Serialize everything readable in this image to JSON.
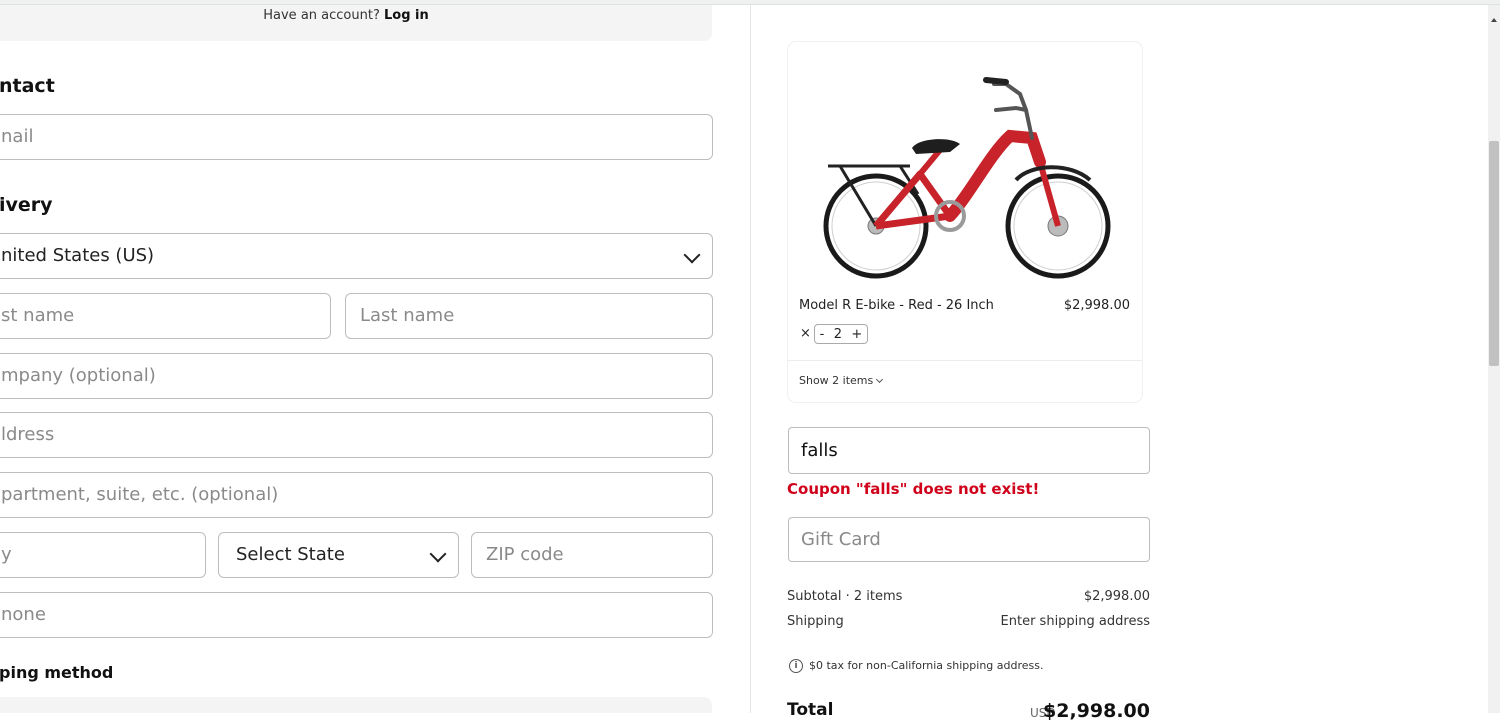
{
  "header": {
    "account_prompt": "Have an account?",
    "login_link": "Log in"
  },
  "contact": {
    "title": "ntact",
    "email_placeholder": "nail"
  },
  "delivery": {
    "title": "ivery",
    "country_value": "nited States (US)",
    "first_name_placeholder": "st name",
    "last_name_placeholder": "Last name",
    "company_placeholder": "mpany (optional)",
    "address_placeholder": "ldress",
    "apartment_placeholder": "partment, suite, etc. (optional)",
    "city_placeholder": "y",
    "state_value": "Select State",
    "zip_placeholder": "ZIP code",
    "phone_placeholder": "none"
  },
  "shipping_method": {
    "title": "ping method"
  },
  "order": {
    "product_name": "Model R E-bike - Red - 26 Inch",
    "product_price": "$2,998.00",
    "qty_multiplier": "×",
    "qty_minus": "-",
    "qty_value": "2",
    "qty_plus": "+",
    "show_items": "Show 2 items",
    "coupon_value": "falls",
    "coupon_error": "Coupon \"falls\" does not exist!",
    "gift_card_placeholder": "Gift Card",
    "subtotal_label": "Subtotal · 2 items",
    "subtotal_value": "$2,998.00",
    "shipping_label": "Shipping",
    "shipping_value": "Enter shipping address",
    "tax_note": "$0 tax for non-California shipping address.",
    "total_label": "Total",
    "total_currency": "USD",
    "total_value": "$2,998.00"
  },
  "colors": {
    "error": "#d0021b",
    "bike_red": "#c8232a",
    "border": "#bdbdbd"
  }
}
